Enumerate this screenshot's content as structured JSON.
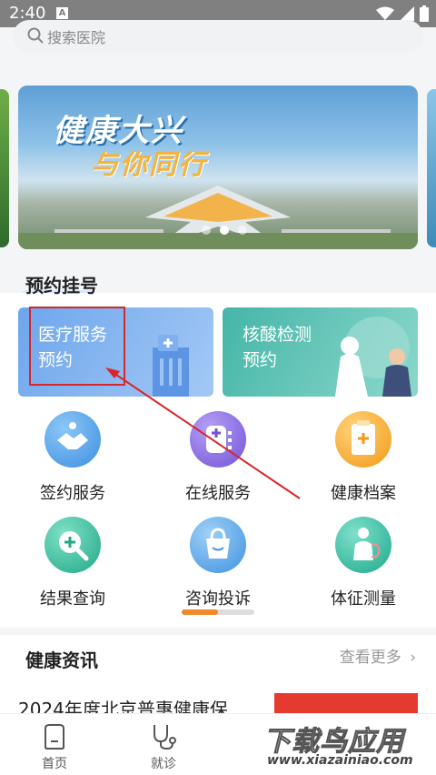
{
  "status": {
    "time": "2:40",
    "app_badge": "A"
  },
  "search": {
    "placeholder": "搜索医院"
  },
  "banner": {
    "line1": "健康大兴",
    "line2": "与你同行"
  },
  "appointment": {
    "title": "预约挂号",
    "cards": [
      {
        "label": "医疗服务\n预约"
      },
      {
        "label": "核酸检测\n预约"
      }
    ]
  },
  "services": [
    {
      "label": "签约服务",
      "icon": "handshake-icon",
      "color": "#5aa6ec"
    },
    {
      "label": "在线服务",
      "icon": "online-service-icon",
      "color": "#8a6de0"
    },
    {
      "label": "健康档案",
      "icon": "health-record-icon",
      "color": "#f5a623"
    },
    {
      "label": "结果查询",
      "icon": "result-search-icon",
      "color": "#33b89b"
    },
    {
      "label": "咨询投诉",
      "icon": "shopping-bag-icon",
      "color": "#4da3e8"
    },
    {
      "label": "体征测量",
      "icon": "stethoscope-body-icon",
      "color": "#2fb39a"
    }
  ],
  "news": {
    "title": "健康资讯",
    "more": "查看更多",
    "first_item": "2024年度北京普惠健康保"
  },
  "tabbar": {
    "items": [
      {
        "label": "首页"
      },
      {
        "label": "就诊"
      }
    ]
  },
  "watermark": {
    "line1": "下载鸟应用",
    "line2": "www.xiazainiao.com"
  }
}
